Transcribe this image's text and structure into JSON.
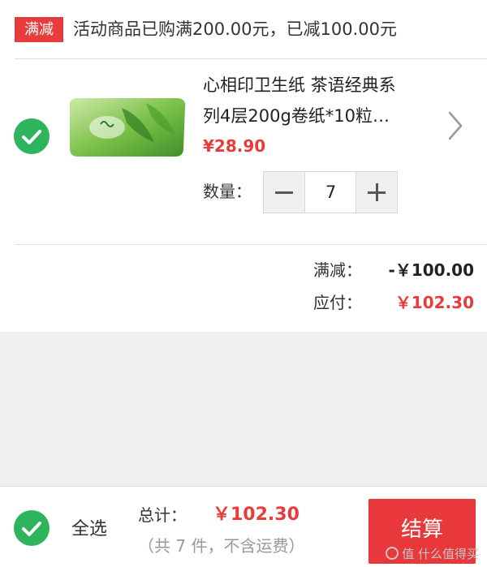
{
  "promo": {
    "badge": "满减",
    "text": "活动商品已购满200.00元，已减100.00元"
  },
  "item": {
    "checked": true,
    "title_line1": "心相印卫生纸 茶语经典系",
    "title_line2": "列4层200g卷纸*10粒…",
    "price": "¥28.90",
    "quantity_label": "数量：",
    "quantity": "7",
    "image_icon": "tissue-package-image"
  },
  "summary": {
    "discount_label": "满减：",
    "discount_value": "-￥100.00",
    "payable_label": "应付：",
    "payable_value": "￥102.30"
  },
  "footer": {
    "select_all_label": "全选",
    "total_label": "总计：",
    "total_value": "￥102.30",
    "total_note": "（共 7 件，不含运费）",
    "checkout_label": "结算"
  },
  "watermark": "值 什么值得买",
  "colors": {
    "accent_red": "#e83c3c",
    "check_green": "#2fb45e",
    "background": "#efeff1"
  }
}
